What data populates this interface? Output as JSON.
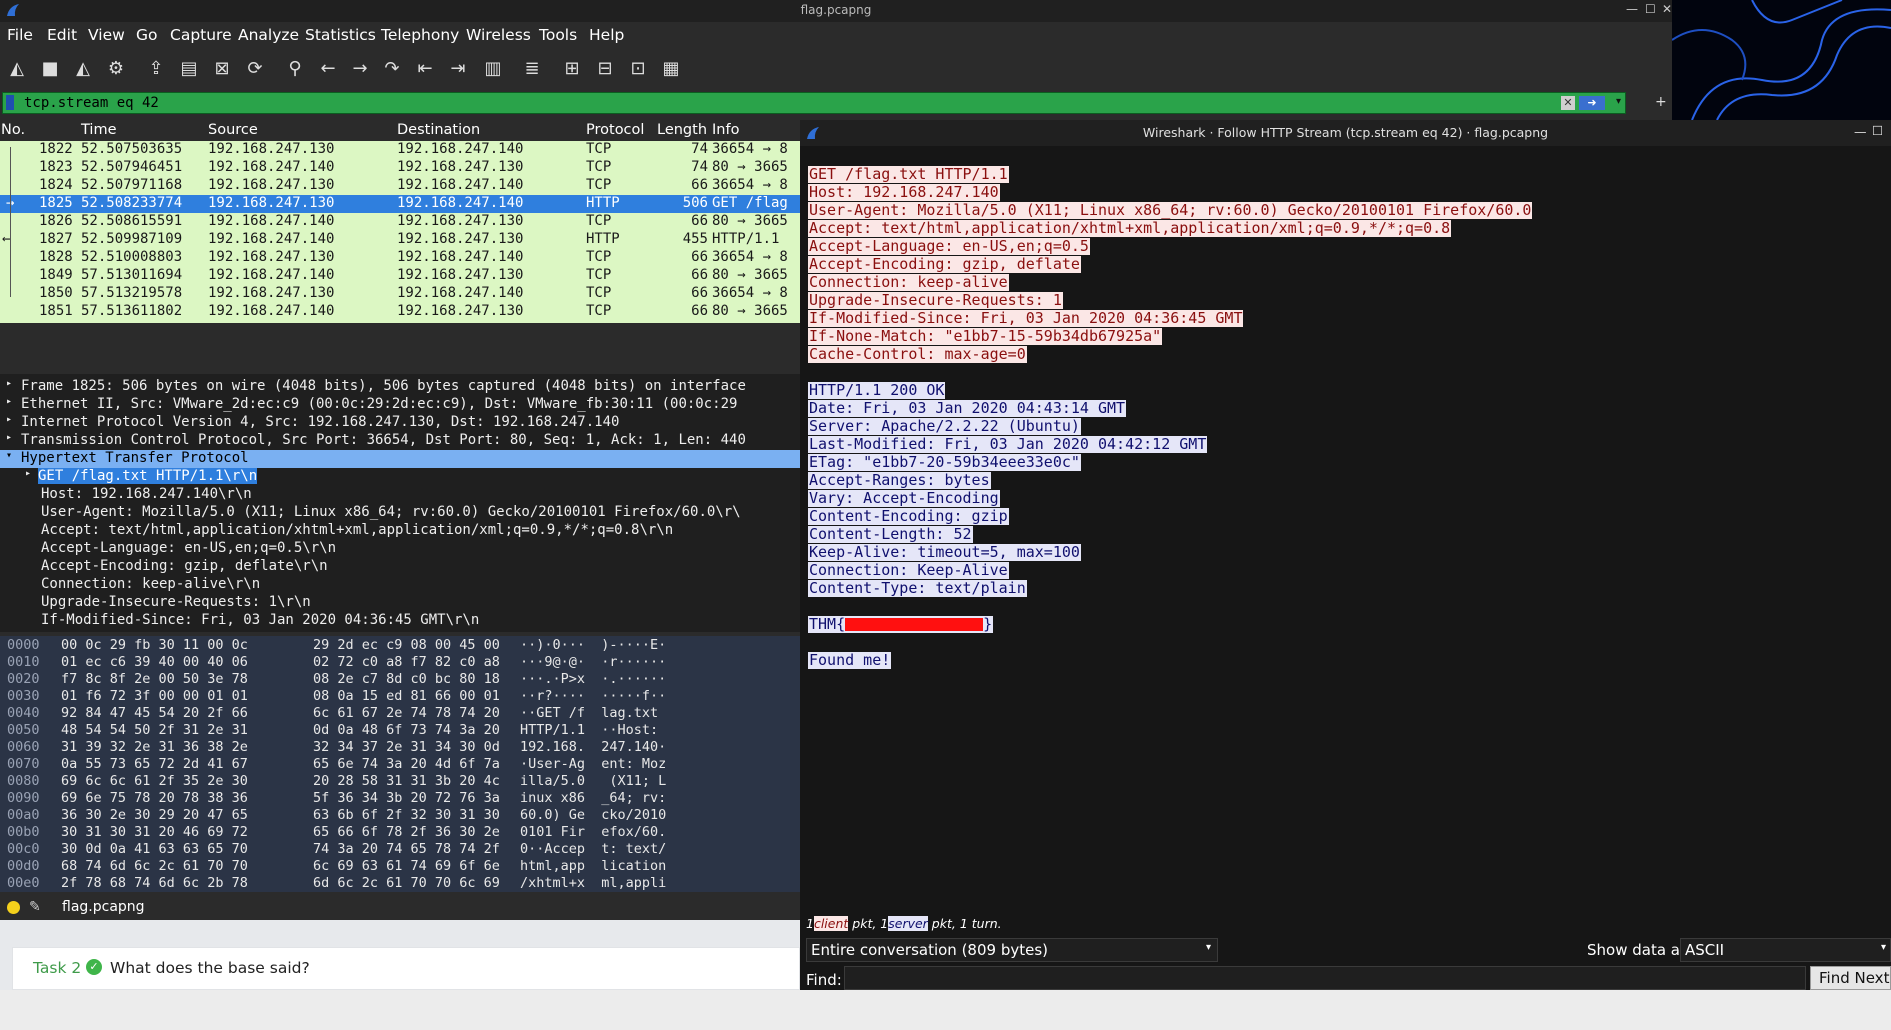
{
  "window": {
    "title": "flag.pcapng"
  },
  "menu": [
    "File",
    "Edit",
    "View",
    "Go",
    "Capture",
    "Analyze",
    "Statistics",
    "Telephony",
    "Wireless",
    "Tools",
    "Help"
  ],
  "filter": {
    "value": "tcp.stream eq 42"
  },
  "columns": [
    "No.",
    "Time",
    "Source",
    "Destination",
    "Protocol",
    "Length",
    "Info"
  ],
  "packets": [
    {
      "no": "1822",
      "time": "52.507503635",
      "src": "192.168.247.130",
      "dst": "192.168.247.140",
      "proto": "TCP",
      "len": "74",
      "info": "36654 → 8"
    },
    {
      "no": "1823",
      "time": "52.507946451",
      "src": "192.168.247.140",
      "dst": "192.168.247.130",
      "proto": "TCP",
      "len": "74",
      "info": "80 → 3665"
    },
    {
      "no": "1824",
      "time": "52.507971168",
      "src": "192.168.247.130",
      "dst": "192.168.247.140",
      "proto": "TCP",
      "len": "66",
      "info": "36654 → 8"
    },
    {
      "no": "1825",
      "time": "52.508233774",
      "src": "192.168.247.130",
      "dst": "192.168.247.140",
      "proto": "HTTP",
      "len": "506",
      "info": "GET /flag"
    },
    {
      "no": "1826",
      "time": "52.508615591",
      "src": "192.168.247.140",
      "dst": "192.168.247.130",
      "proto": "TCP",
      "len": "66",
      "info": "80 → 3665"
    },
    {
      "no": "1827",
      "time": "52.509987109",
      "src": "192.168.247.140",
      "dst": "192.168.247.130",
      "proto": "HTTP",
      "len": "455",
      "info": "HTTP/1.1"
    },
    {
      "no": "1828",
      "time": "52.510008803",
      "src": "192.168.247.130",
      "dst": "192.168.247.140",
      "proto": "TCP",
      "len": "66",
      "info": "36654 → 8"
    },
    {
      "no": "1849",
      "time": "57.513011694",
      "src": "192.168.247.140",
      "dst": "192.168.247.130",
      "proto": "TCP",
      "len": "66",
      "info": "80 → 3665"
    },
    {
      "no": "1850",
      "time": "57.513219578",
      "src": "192.168.247.130",
      "dst": "192.168.247.140",
      "proto": "TCP",
      "len": "66",
      "info": "36654 → 8"
    },
    {
      "no": "1851",
      "time": "57.513611802",
      "src": "192.168.247.140",
      "dst": "192.168.247.130",
      "proto": "TCP",
      "len": "66",
      "info": "80 → 3665"
    }
  ],
  "details": [
    "Frame 1825: 506 bytes on wire (4048 bits), 506 bytes captured (4048 bits) on interface",
    "Ethernet II, Src: VMware_2d:ec:c9 (00:0c:29:2d:ec:c9), Dst: VMware_fb:30:11 (00:0c:29",
    "Internet Protocol Version 4, Src: 192.168.247.130, Dst: 192.168.247.140",
    "Transmission Control Protocol, Src Port: 36654, Dst Port: 80, Seq: 1, Ack: 1, Len: 440",
    "Hypertext Transfer Protocol",
    "GET /flag.txt HTTP/1.1\\r\\n",
    "Host: 192.168.247.140\\r\\n",
    "User-Agent: Mozilla/5.0 (X11; Linux x86_64; rv:60.0) Gecko/20100101 Firefox/60.0\\r\\",
    "Accept: text/html,application/xhtml+xml,application/xml;q=0.9,*/*;q=0.8\\r\\n",
    "Accept-Language: en-US,en;q=0.5\\r\\n",
    "Accept-Encoding: gzip, deflate\\r\\n",
    "Connection: keep-alive\\r\\n",
    "Upgrade-Insecure-Requests: 1\\r\\n",
    "If-Modified-Since: Fri, 03 Jan 2020 04:36:45 GMT\\r\\n"
  ],
  "hex": [
    {
      "o": "0000",
      "b1": "00 0c 29 fb 30 11 00 0c",
      "b2": "29 2d ec c9 08 00 45 00",
      "a": "··)·0···  )-····E·"
    },
    {
      "o": "0010",
      "b1": "01 ec c6 39 40 00 40 06",
      "b2": "02 72 c0 a8 f7 82 c0 a8",
      "a": "···9@·@·  ·r······"
    },
    {
      "o": "0020",
      "b1": "f7 8c 8f 2e 00 50 3e 78",
      "b2": "08 2e c7 8d c0 bc 80 18",
      "a": "···.·P>x  ·.······"
    },
    {
      "o": "0030",
      "b1": "01 f6 72 3f 00 00 01 01",
      "b2": "08 0a 15 ed 81 66 00 01",
      "a": "··r?····  ·····f··"
    },
    {
      "o": "0040",
      "b1": "92 84 47 45 54 20 2f 66",
      "b2": "6c 61 67 2e 74 78 74 20",
      "a": "··GET /f  lag.txt "
    },
    {
      "o": "0050",
      "b1": "48 54 54 50 2f 31 2e 31",
      "b2": "0d 0a 48 6f 73 74 3a 20",
      "a": "HTTP/1.1  ··Host: "
    },
    {
      "o": "0060",
      "b1": "31 39 32 2e 31 36 38 2e",
      "b2": "32 34 37 2e 31 34 30 0d",
      "a": "192.168.  247.140·"
    },
    {
      "o": "0070",
      "b1": "0a 55 73 65 72 2d 41 67",
      "b2": "65 6e 74 3a 20 4d 6f 7a",
      "a": "·User-Ag  ent: Moz"
    },
    {
      "o": "0080",
      "b1": "69 6c 6c 61 2f 35 2e 30",
      "b2": "20 28 58 31 31 3b 20 4c",
      "a": "illa/5.0   (X11; L"
    },
    {
      "o": "0090",
      "b1": "69 6e 75 78 20 78 38 36",
      "b2": "5f 36 34 3b 20 72 76 3a",
      "a": "inux x86  _64; rv:"
    },
    {
      "o": "00a0",
      "b1": "36 30 2e 30 29 20 47 65",
      "b2": "63 6b 6f 2f 32 30 31 30",
      "a": "60.0) Ge  cko/2010"
    },
    {
      "o": "00b0",
      "b1": "30 31 30 31 20 46 69 72",
      "b2": "65 66 6f 78 2f 36 30 2e",
      "a": "0101 Fir  efox/60."
    },
    {
      "o": "00c0",
      "b1": "30 0d 0a 41 63 63 65 70",
      "b2": "74 3a 20 74 65 78 74 2f",
      "a": "0··Accep  t: text/"
    },
    {
      "o": "00d0",
      "b1": "68 74 6d 6c 2c 61 70 70",
      "b2": "6c 69 63 61 74 69 6f 6e",
      "a": "html,app  lication"
    },
    {
      "o": "00e0",
      "b1": "2f 78 68 74 6d 6c 2b 78",
      "b2": "6d 6c 2c 61 70 70 6c 69",
      "a": "/xhtml+x  ml,appli"
    }
  ],
  "status": {
    "file": "flag.pcapng"
  },
  "task": {
    "label": "Task 2",
    "question": "What does the base said?"
  },
  "dialog": {
    "title": "Wireshark · Follow HTTP Stream (tcp.stream eq 42) · flag.pcapng",
    "client_lines": [
      "GET /flag.txt HTTP/1.1",
      "Host: 192.168.247.140",
      "User-Agent: Mozilla/5.0 (X11; Linux x86_64; rv:60.0) Gecko/20100101 Firefox/60.0",
      "Accept: text/html,application/xhtml+xml,application/xml;q=0.9,*/*;q=0.8",
      "Accept-Language: en-US,en;q=0.5",
      "Accept-Encoding: gzip, deflate",
      "Connection: keep-alive",
      "Upgrade-Insecure-Requests: 1",
      "If-Modified-Since: Fri, 03 Jan 2020 04:36:45 GMT",
      "If-None-Match: \"e1bb7-15-59b34db67925a\"",
      "Cache-Control: max-age=0"
    ],
    "server_lines": [
      "HTTP/1.1 200 OK",
      "Date: Fri, 03 Jan 2020 04:43:14 GMT",
      "Server: Apache/2.2.22 (Ubuntu)",
      "Last-Modified: Fri, 03 Jan 2020 04:42:12 GMT",
      "ETag: \"e1bb7-20-59b34eee33e0c\"",
      "Accept-Ranges: bytes",
      "Vary: Accept-Encoding",
      "Content-Encoding: gzip",
      "Content-Length: 52",
      "Keep-Alive: timeout=5, max=100",
      "Connection: Keep-Alive",
      "Content-Type: text/plain"
    ],
    "flag_prefix": "THM{",
    "flag_suffix": "}",
    "found": "Found me!",
    "summary": {
      "n1": "1",
      "client": "client",
      "pkt1": " pkt, 1",
      "server": "server",
      "rest": " pkt, 1 turn."
    },
    "conversation": "Entire conversation (809 bytes)",
    "show_as_label": "Show data as",
    "show_as_value": "ASCII",
    "find_label": "Find:",
    "find_next": "Find Next"
  }
}
